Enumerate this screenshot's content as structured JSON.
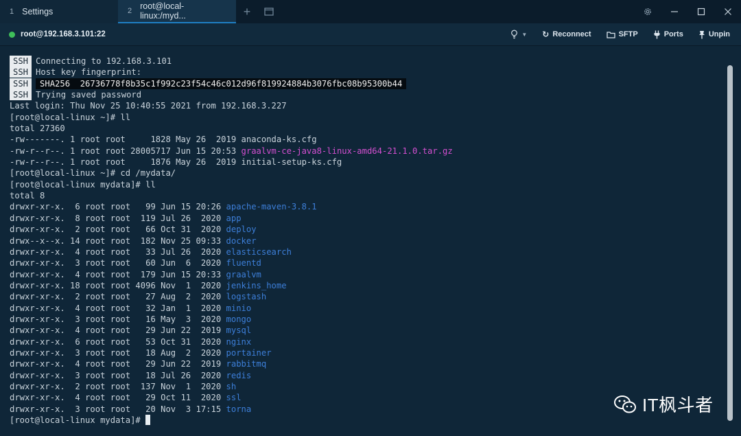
{
  "tabs": [
    {
      "num": "1",
      "label": "Settings"
    },
    {
      "num": "2",
      "label": "root@local-linux:/myd..."
    }
  ],
  "connbar": {
    "host": "root@192.168.3.101:22",
    "reconnect": "Reconnect",
    "sftp": "SFTP",
    "ports": "Ports",
    "unpin": "Unpin"
  },
  "terminal": {
    "ssh_badge": "SSH",
    "ssh_lines": [
      "Connecting to 192.168.3.101",
      "Host key fingerprint:",
      "",
      "Trying saved password"
    ],
    "fingerprint": "SHA256  26736778f8b35c1f992c23f54c46c012d96f819924884b3076fbc08b95300b44",
    "lines_before": [
      "Last login: Thu Nov 25 10:40:55 2021 from 192.168.3.227",
      "[root@local-linux ~]# ll",
      "total 27360",
      "-rw-------. 1 root root     1828 May 26  2019 anaconda-ks.cfg"
    ],
    "graal_prefix": "-rw-r--r--. 1 root root 28005717 Jun 15 20:53 ",
    "graal_file": "graalvm-ce-java8-linux-amd64-21.1.0.tar.gz",
    "lines_mid": [
      "-rw-r--r--. 1 root root     1876 May 26  2019 initial-setup-ks.cfg",
      "[root@local-linux ~]# cd /mydata/",
      "[root@local-linux mydata]# ll",
      "total 8"
    ],
    "dirs": [
      {
        "meta": "drwxr-xr-x.  6 root root   99 Jun 15 20:26 ",
        "name": "apache-maven-3.8.1"
      },
      {
        "meta": "drwxr-xr-x.  8 root root  119 Jul 26  2020 ",
        "name": "app"
      },
      {
        "meta": "drwxr-xr-x.  2 root root   66 Oct 31  2020 ",
        "name": "deploy"
      },
      {
        "meta": "drwx--x--x. 14 root root  182 Nov 25 09:33 ",
        "name": "docker"
      },
      {
        "meta": "drwxr-xr-x.  4 root root   33 Jul 26  2020 ",
        "name": "elasticsearch"
      },
      {
        "meta": "drwxr-xr-x.  3 root root   60 Jun  6  2020 ",
        "name": "fluentd"
      },
      {
        "meta": "drwxr-xr-x.  4 root root  179 Jun 15 20:33 ",
        "name": "graalvm"
      },
      {
        "meta": "drwxr-xr-x. 18 root root 4096 Nov  1  2020 ",
        "name": "jenkins_home"
      },
      {
        "meta": "drwxr-xr-x.  2 root root   27 Aug  2  2020 ",
        "name": "logstash"
      },
      {
        "meta": "drwxr-xr-x.  4 root root   32 Jan  1  2020 ",
        "name": "minio"
      },
      {
        "meta": "drwxr-xr-x.  3 root root   16 May  3  2020 ",
        "name": "mongo"
      },
      {
        "meta": "drwxr-xr-x.  4 root root   29 Jun 22  2019 ",
        "name": "mysql"
      },
      {
        "meta": "drwxr-xr-x.  6 root root   53 Oct 31  2020 ",
        "name": "nginx"
      },
      {
        "meta": "drwxr-xr-x.  3 root root   18 Aug  2  2020 ",
        "name": "portainer"
      },
      {
        "meta": "drwxr-xr-x.  4 root root   29 Jun 22  2019 ",
        "name": "rabbitmq"
      },
      {
        "meta": "drwxr-xr-x.  3 root root   18 Jul 26  2020 ",
        "name": "redis"
      },
      {
        "meta": "drwxr-xr-x.  2 root root  137 Nov  1  2020 ",
        "name": "sh"
      },
      {
        "meta": "drwxr-xr-x.  4 root root   29 Oct 11  2020 ",
        "name": "ssl"
      },
      {
        "meta": "drwxr-xr-x.  3 root root   20 Nov  3 17:15 ",
        "name": "torna"
      }
    ],
    "prompt": "[root@local-linux mydata]# "
  },
  "watermark": "IT枫斗者",
  "colors": {
    "status_online": "#3fbf5a",
    "dir": "#3d7fd9",
    "archive": "#d44fd0"
  }
}
